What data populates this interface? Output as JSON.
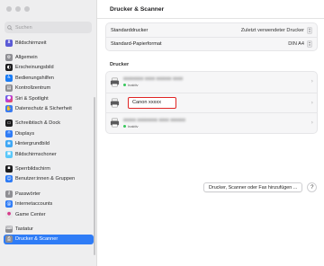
{
  "sidebar": {
    "search_placeholder": "Suchen",
    "items": [
      {
        "label": "Bildschirmzeit",
        "icon": "hourglass-icon",
        "color": "#5b5bd6"
      },
      {
        "label": "Allgemein",
        "icon": "gear-icon",
        "color": "#8e8e93"
      },
      {
        "label": "Erscheinungsbild",
        "icon": "appearance-icon",
        "color": "#1d1d1f"
      },
      {
        "label": "Bedienungshilfen",
        "icon": "accessibility-icon",
        "color": "#1a7cf5"
      },
      {
        "label": "Kontrollzentrum",
        "icon": "control-center-icon",
        "color": "#8e8e93"
      },
      {
        "label": "Siri & Spotlight",
        "icon": "siri-icon",
        "color": "#c03bd8"
      },
      {
        "label": "Datenschutz & Sicherheit",
        "icon": "hand-icon",
        "color": "#3a7bf0"
      },
      {
        "label": "Schreibtisch & Dock",
        "icon": "dock-icon",
        "color": "#1d1d1f"
      },
      {
        "label": "Displays",
        "icon": "display-icon",
        "color": "#2f7cf6"
      },
      {
        "label": "Hintergrundbild",
        "icon": "wallpaper-icon",
        "color": "#3fa7f5"
      },
      {
        "label": "Bildschirmschoner",
        "icon": "screensaver-icon",
        "color": "#5ac8fa"
      },
      {
        "label": "Sperrbildschirm",
        "icon": "lock-icon",
        "color": "#1d1d1f"
      },
      {
        "label": "Benutzer:innen & Gruppen",
        "icon": "users-icon",
        "color": "#2f7cf6"
      },
      {
        "label": "Passwörter",
        "icon": "key-icon",
        "color": "#8e8e93"
      },
      {
        "label": "Internetaccounts",
        "icon": "at-icon",
        "color": "#2f7cf6"
      },
      {
        "label": "Game Center",
        "icon": "game-center-icon",
        "color": "#e8e8ea"
      },
      {
        "label": "Tastatur",
        "icon": "keyboard-icon",
        "color": "#8e8e93"
      },
      {
        "label": "Drucker & Scanner",
        "icon": "printer-icon",
        "color": "#8e8e93"
      }
    ]
  },
  "main": {
    "title": "Drucker & Scanner",
    "settings": [
      {
        "label": "Standarddrucker",
        "value": "Zuletzt verwendeter Drucker"
      },
      {
        "label": "Standard-Papierformat",
        "value": "DIN A4"
      }
    ],
    "printers_heading": "Drucker",
    "printers": [
      {
        "name": "xxxxxxxx xxxx xxxxxx xxxx",
        "status": "Inaktiv",
        "blurred": true
      },
      {
        "name": "Canon xxxxx",
        "status": "",
        "blurred": false,
        "highlighted": true
      },
      {
        "name": "xxxxx xxxxxxxx xxxx xxxxxx",
        "status": "Inaktiv",
        "blurred": true
      }
    ],
    "add_button": "Drucker, Scanner oder Fax hinzufügen ...",
    "help_button": "?"
  },
  "colors": {
    "selected": "#2f7cf6",
    "highlight_border": "#e02424",
    "status_dot": "#35c759"
  }
}
